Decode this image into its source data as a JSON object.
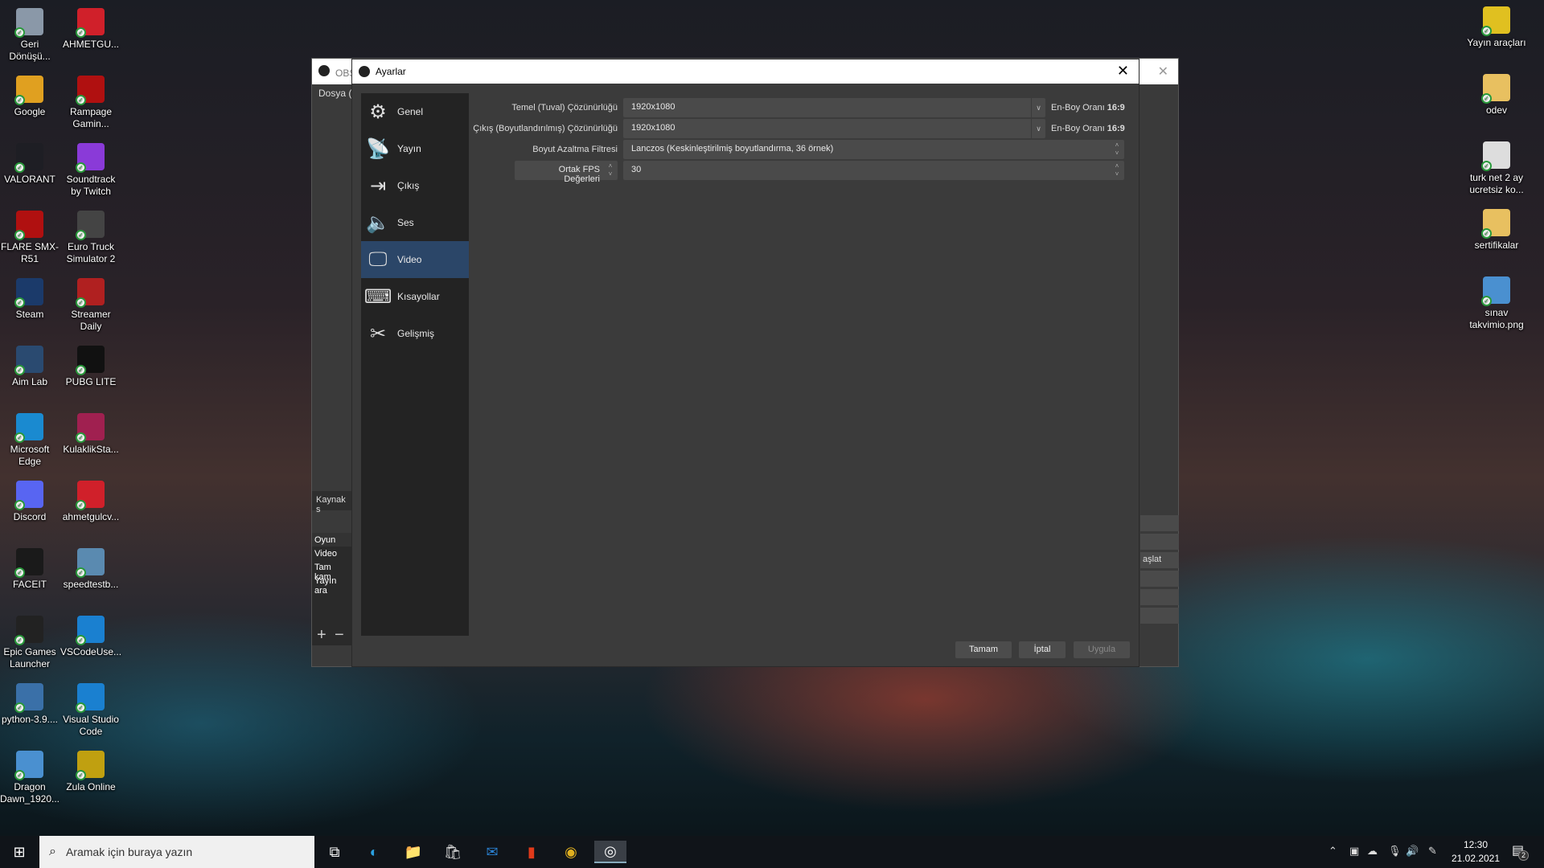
{
  "desktop": {
    "left_icons": [
      {
        "label": "Geri Dönüşü...",
        "icon": "recycle-bin-icon",
        "color": "#8a98a8"
      },
      {
        "label": "AHMETGU...",
        "icon": "pdf-icon",
        "color": "#d0202a"
      },
      {
        "label": "Google",
        "icon": "chrome-icon",
        "color": "#e0a020"
      },
      {
        "label": "Rampage Gamin...",
        "icon": "rampage-icon",
        "color": "#b01010"
      },
      {
        "label": "VALORANT",
        "icon": "valorant-icon",
        "color": "#1e1e24"
      },
      {
        "label": "Soundtrack by Twitch",
        "icon": "twitch-icon",
        "color": "#8a3ad8"
      },
      {
        "label": "FLARE SMX-R51",
        "icon": "flare-icon",
        "color": "#b01010"
      },
      {
        "label": "Euro Truck Simulator 2",
        "icon": "truck-icon",
        "color": "#444"
      },
      {
        "label": "Steam",
        "icon": "steam-icon",
        "color": "#1b3a6a"
      },
      {
        "label": "Streamer Daily",
        "icon": "streamer-icon",
        "color": "#b02020"
      },
      {
        "label": "Aim Lab",
        "icon": "aimlab-icon",
        "color": "#2a4a70"
      },
      {
        "label": "PUBG LITE",
        "icon": "pubg-icon",
        "color": "#111"
      },
      {
        "label": "Microsoft Edge",
        "icon": "edge-icon",
        "color": "#1a8ad0"
      },
      {
        "label": "KulaklikSta...",
        "icon": "winrar-icon",
        "color": "#a02050"
      },
      {
        "label": "Discord",
        "icon": "discord-icon",
        "color": "#5865f2"
      },
      {
        "label": "ahmetgulcv...",
        "icon": "pdf-icon",
        "color": "#d0202a"
      },
      {
        "label": "FACEIT",
        "icon": "faceit-icon",
        "color": "#1a1a1a"
      },
      {
        "label": "speedtestb...",
        "icon": "installer-icon",
        "color": "#5a8ab0"
      },
      {
        "label": "Epic Games Launcher",
        "icon": "epic-icon",
        "color": "#222"
      },
      {
        "label": "VSCodeUse...",
        "icon": "vscode-icon",
        "color": "#1a80d0"
      },
      {
        "label": "python-3.9....",
        "icon": "python-icon",
        "color": "#3a70a8"
      },
      {
        "label": "Visual Studio Code",
        "icon": "vscode-icon",
        "color": "#1a80d0"
      },
      {
        "label": "Dragon Dawn_1920...",
        "icon": "image-file-icon",
        "color": "#4a90d0"
      },
      {
        "label": "Zula Online",
        "icon": "zula-icon",
        "color": "#c0a010"
      }
    ],
    "right_icons": [
      {
        "label": "Yayın araçları",
        "icon": "shield-icon",
        "color": "#e0c020"
      },
      {
        "label": "odev",
        "icon": "folder-icon",
        "color": "#e8c060"
      },
      {
        "label": "turk net  2 ay ucretsiz ko...",
        "icon": "text-file-icon",
        "color": "#ddd"
      },
      {
        "label": "sertifikalar",
        "icon": "folder-icon",
        "color": "#e8c060"
      },
      {
        "label": "sınav takvimio.png",
        "icon": "image-file-icon",
        "color": "#4a90d0"
      }
    ]
  },
  "obs_main": {
    "title": "OBS",
    "menu": "Dosya (",
    "sources_label": "Kaynak s",
    "scenes": [
      "Oyun",
      "Video",
      "Tam kam",
      "Yayın ara"
    ],
    "right_button": "aşlat"
  },
  "settings": {
    "title": "Ayarlar",
    "sidebar": [
      {
        "label": "Genel",
        "icon": "gear-icon"
      },
      {
        "label": "Yayın",
        "icon": "broadcast-antenna-icon"
      },
      {
        "label": "Çıkış",
        "icon": "output-monitor-icon"
      },
      {
        "label": "Ses",
        "icon": "speaker-icon"
      },
      {
        "label": "Video",
        "icon": "monitor-icon",
        "active": true
      },
      {
        "label": "Kısayollar",
        "icon": "keyboard-icon"
      },
      {
        "label": "Gelişmiş",
        "icon": "tools-icon"
      }
    ],
    "base_resolution": {
      "label": "Temel (Tuval) Çözünürlüğü",
      "value": "1920x1080",
      "aspect_label": "En-Boy Oranı",
      "aspect_value": "16:9"
    },
    "output_resolution": {
      "label": "Çıkış (Boyutlandırılmış) Çözünürlüğü",
      "value": "1920x1080",
      "aspect_label": "En-Boy Oranı",
      "aspect_value": "16:9"
    },
    "downscale_filter": {
      "label": "Boyut Azaltma Filtresi",
      "value": "Lanczos (Keskinleştirilmiş boyutlandırma, 36 örnek)"
    },
    "fps": {
      "type": "Ortak FPS Değerleri",
      "value": "30"
    },
    "buttons": {
      "ok": "Tamam",
      "cancel": "İptal",
      "apply": "Uygula"
    }
  },
  "taskbar": {
    "search_placeholder": "Aramak için buraya yazın",
    "time": "12:30",
    "date": "21.02.2021",
    "notifications": "2",
    "apps": [
      "task-view-icon",
      "edge-icon",
      "file-explorer-icon",
      "store-icon",
      "mail-icon",
      "office-icon",
      "chrome-icon",
      "obs-icon"
    ]
  }
}
